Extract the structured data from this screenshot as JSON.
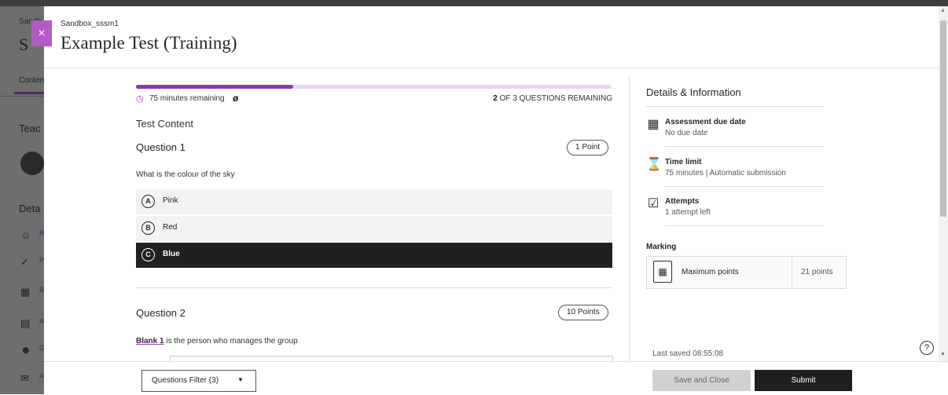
{
  "background_page": {
    "course_small": "Sandb",
    "course_big": "S",
    "tab": "Conten",
    "teach": "Teac",
    "details": "Deta",
    "items": [
      {
        "icon": "people-icon",
        "text": "R"
      },
      {
        "icon": "check-circle-icon",
        "text": "P"
      },
      {
        "icon": "book-icon",
        "text": "B"
      },
      {
        "icon": "clipboard-icon",
        "text": "A"
      },
      {
        "icon": "group-icon",
        "text": "G"
      },
      {
        "icon": "megaphone-icon",
        "text": "A"
      }
    ]
  },
  "panel": {
    "close_glyph": "×",
    "breadcrumb": "Sandbox_sssm1",
    "title": "Example Test (Training)"
  },
  "progress": {
    "fraction": 0.33,
    "timer_text": "75 minutes remaining",
    "remaining_count": "2",
    "remaining_suffix": "OF 3 QUESTIONS REMAINING"
  },
  "content_label": "Test Content",
  "questions": [
    {
      "title": "Question 1",
      "points": "1 Point",
      "text": "What is the colour of the sky",
      "options": [
        {
          "letter": "A",
          "label": "Pink"
        },
        {
          "letter": "B",
          "label": "Red"
        },
        {
          "letter": "C",
          "label": "Blue",
          "selected": true
        }
      ]
    },
    {
      "title": "Question 2",
      "points": "10 Points",
      "blank_label": "Blank 1",
      "text": " is the person who manages the group"
    }
  ],
  "details": {
    "title": "Details & Information",
    "items": [
      {
        "icon": "calendar-icon",
        "title": "Assessment due date",
        "value": "No due date"
      },
      {
        "icon": "hourglass-icon",
        "title": "Time limit",
        "value": "75 minutes | Automatic submission"
      },
      {
        "icon": "checkbox-icon",
        "title": "Attempts",
        "value": "1 attempt left"
      }
    ],
    "marking_title": "Marking",
    "marking_label": "Maximum points",
    "marking_points": "21 points",
    "last_saved": "Last saved 08:55:08"
  },
  "footer": {
    "filter_label": "Questions Filter (3)",
    "save_close": "Save and Close",
    "submit": "Submit"
  },
  "colors": {
    "accent": "#8b3aa6",
    "close_tab": "#b35ac4",
    "selected_option": "#202020"
  }
}
